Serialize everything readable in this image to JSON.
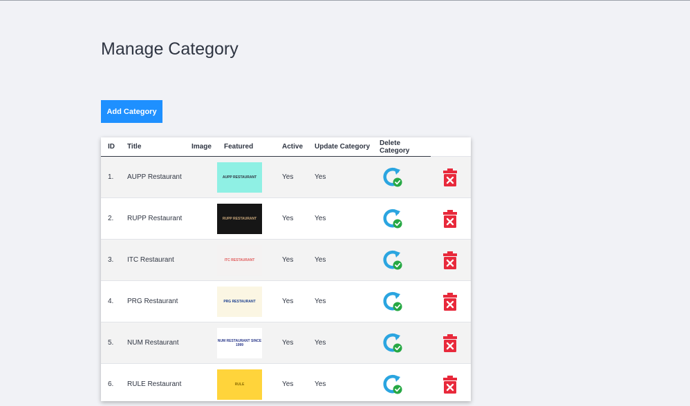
{
  "page": {
    "title": "Manage Category",
    "add_button_label": "Add Category"
  },
  "table": {
    "headers": [
      "ID",
      "Title",
      "Image",
      "Featured",
      "Active",
      "Update Category",
      "Delete Category"
    ],
    "rows": [
      {
        "id": "1.",
        "title": "AUPP Restaurant",
        "featured": "Yes",
        "active": "Yes",
        "thumb_text": "AUPP RESTAURANT",
        "thumb_bg": "#8ff0e4",
        "thumb_fg": "#2f3542"
      },
      {
        "id": "2.",
        "title": "RUPP Restaurant",
        "featured": "Yes",
        "active": "Yes",
        "thumb_text": "RUPP RESTAURANT",
        "thumb_bg": "#161616",
        "thumb_fg": "#c9a77a"
      },
      {
        "id": "3.",
        "title": "ITC Restaurant",
        "featured": "Yes",
        "active": "Yes",
        "thumb_text": "ITC RESTAURANT",
        "thumb_bg": "#f4f2f2",
        "thumb_fg": "#e05a5a"
      },
      {
        "id": "4.",
        "title": "PRG Restaurant",
        "featured": "Yes",
        "active": "Yes",
        "thumb_text": "PRG RESTAURANT",
        "thumb_bg": "#fbf6e3",
        "thumb_fg": "#1b3f8f"
      },
      {
        "id": "5.",
        "title": "NUM Restaurant",
        "featured": "Yes",
        "active": "Yes",
        "thumb_text": "NUM RESTAURANT SINCE 1999",
        "thumb_bg": "#ffffff",
        "thumb_fg": "#2d3b8c"
      },
      {
        "id": "6.",
        "title": "RULE Restaurant",
        "featured": "Yes",
        "active": "Yes",
        "thumb_text": "RULE",
        "thumb_bg": "#ffd43b",
        "thumb_fg": "#8a6b00"
      }
    ]
  },
  "icons": {
    "update": "refresh-check-icon",
    "delete": "trash-x-icon"
  },
  "colors": {
    "accent": "#1e90ff",
    "update_icon": "#2ba5e0",
    "check_badge": "#27a844",
    "delete_icon": "#e8293b"
  }
}
